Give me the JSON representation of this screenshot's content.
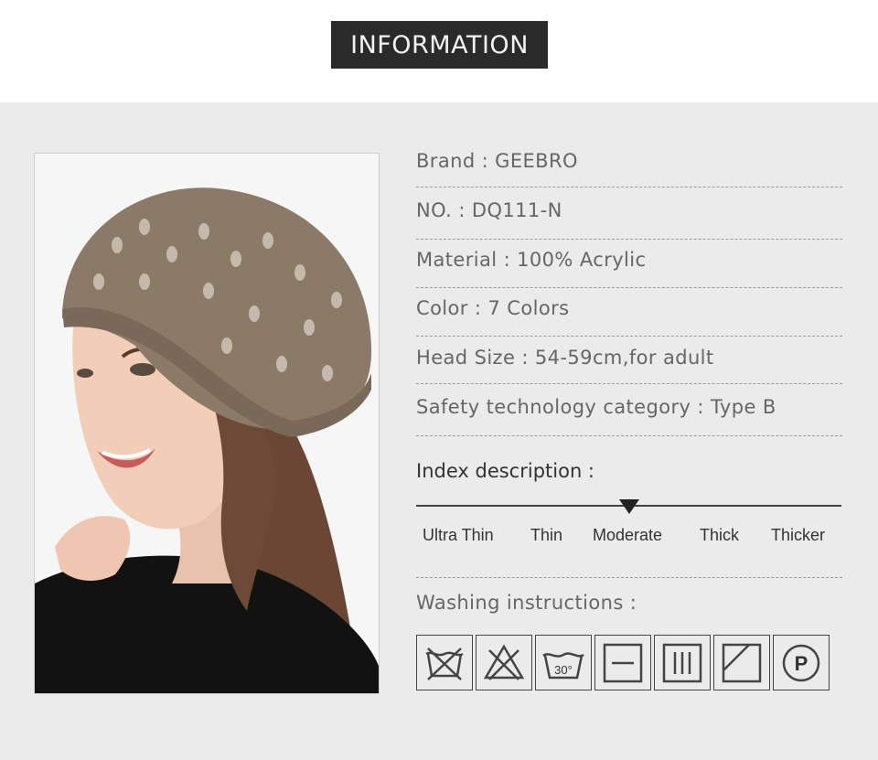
{
  "header": {
    "title": "INFORMATION"
  },
  "photo": {
    "icon": "model-wearing-beret-image"
  },
  "specs": [
    {
      "label": "Brand",
      "value": "GEEBRO",
      "text": "Brand : GEEBRO"
    },
    {
      "label": "NO.",
      "value": "DQ111-N",
      "text": "NO. : DQ111-N"
    },
    {
      "label": "Material",
      "value": "100% Acrylic",
      "text": "Material : 100% Acrylic"
    },
    {
      "label": "Color",
      "value": "7 Colors",
      "text": "Color : 7 Colors"
    },
    {
      "label": "Head Size",
      "value": "54-59cm,for adult",
      "text": "Head Size : 54-59cm,for adult"
    },
    {
      "label": "Safety technology category",
      "value": "Type B",
      "text": "Safety technology category : Type B"
    }
  ],
  "index": {
    "title": "Index description :",
    "levels": [
      "Ultra Thin",
      "Thin",
      "Moderate",
      "Thick",
      "Thicker"
    ],
    "selected": "Moderate"
  },
  "washing": {
    "title": "Washing instructions :",
    "temperature": "30°",
    "icons": [
      "do-not-wash-icon",
      "do-not-bleach-icon",
      "wash-30-icon",
      "dry-flat-icon",
      "drip-dry-icon",
      "dry-in-shade-icon",
      "professional-dry-clean-p-icon"
    ]
  },
  "colors": {
    "banner": "#2a2a2a",
    "panel": "#ebebeb",
    "beret": "#8c7a68"
  }
}
